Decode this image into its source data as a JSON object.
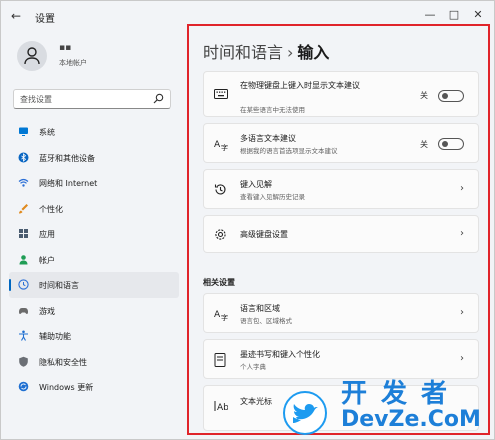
{
  "window": {
    "title": "设置",
    "back": "←",
    "minimize": "—",
    "maximize": "□",
    "close": "✕"
  },
  "user": {
    "name": "▪▪",
    "account": "本地帐户"
  },
  "search": {
    "placeholder": "查找设置"
  },
  "nav": [
    {
      "label": "系统",
      "icon": "monitor-icon",
      "color": "#0078d4"
    },
    {
      "label": "蓝牙和其他设备",
      "icon": "bluetooth-icon",
      "color": "#0a66c2"
    },
    {
      "label": "网络和 Internet",
      "icon": "wifi-icon",
      "color": "#2b6fd6"
    },
    {
      "label": "个性化",
      "icon": "brush-icon",
      "color": "#e08a1e"
    },
    {
      "label": "应用",
      "icon": "apps-icon",
      "color": "#4a5c70"
    },
    {
      "label": "帐户",
      "icon": "person-icon",
      "color": "#1f9d55"
    },
    {
      "label": "时间和语言",
      "icon": "globe-clock-icon",
      "color": "#2b6fd6",
      "active": true
    },
    {
      "label": "游戏",
      "icon": "gamepad-icon",
      "color": "#6b6b6b"
    },
    {
      "label": "辅助功能",
      "icon": "accessibility-icon",
      "color": "#1f6fd1"
    },
    {
      "label": "隐私和安全性",
      "icon": "shield-icon",
      "color": "#6b6f75"
    },
    {
      "label": "Windows 更新",
      "icon": "update-icon",
      "color": "#1f6fd1"
    }
  ],
  "breadcrumb": {
    "parent": "时间和语言",
    "sep": "›",
    "current": "输入"
  },
  "cards": [
    {
      "title": "在物理键盘上键入时显示文本建议",
      "sub": "在某些语言中无法使用",
      "control": "toggle",
      "state": "关",
      "icon": "keyboard-icon"
    },
    {
      "title": "多语言文本建议",
      "sub": "根据我的语言首选项显示文本建议",
      "control": "toggle",
      "state": "关",
      "icon": "language-icon"
    },
    {
      "title": "键入见解",
      "sub": "查看键入见解历史记录",
      "control": "chevron",
      "icon": "history-icon"
    },
    {
      "title": "高级键盘设置",
      "sub": "",
      "control": "chevron",
      "icon": "gear-icon"
    }
  ],
  "related": {
    "heading": "相关设置",
    "cards": [
      {
        "title": "语言和区域",
        "sub": "语言包、区域格式",
        "icon": "language-icon"
      },
      {
        "title": "墨迹书写和键入个性化",
        "sub": "个人字典",
        "icon": "notebook-icon"
      },
      {
        "title": "文本光标",
        "sub": "",
        "icon": "text-cursor-icon"
      }
    ]
  },
  "chevron": "›",
  "watermark": {
    "top": "开发者",
    "bottom": "DevZe.CoM"
  },
  "colors": {
    "accent": "#0067c0",
    "highlight": "#e0242a",
    "watermark": "#1d7fd8"
  }
}
